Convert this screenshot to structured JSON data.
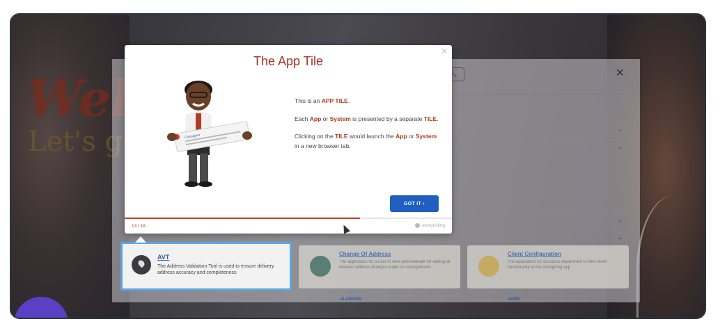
{
  "background": {
    "welcome_text": "Wel",
    "sub_text": "Let's g"
  },
  "app": {
    "tiles": [
      {
        "title": "Change Of Address",
        "description": "The application for a user to view and evaluate for editing all receiver address changes made on consignments"
      },
      {
        "title": "Client Configuration",
        "description": "The application for accounts department to limit client functionality in the consigning app"
      }
    ],
    "row2_labels": [
      "eLANDING",
      "eSIRD"
    ]
  },
  "highlight_tile": {
    "title": "AVT",
    "description": "The Address Validation Tool is used to ensure delivery address accuracy and completeness",
    "icon": "map-pin-icon"
  },
  "tour": {
    "title": "The App Tile",
    "p1_pre": "This is an ",
    "p1_hl": "APP TILE",
    "p1_post": ".",
    "p2_pre": "Each ",
    "p2_hl1": "App",
    "p2_mid": " or ",
    "p2_hl2": "System",
    "p2_mid2": " is presented by a separate ",
    "p2_hl3": "TILE",
    "p2_post": ".",
    "p3_pre": "Clicking on the ",
    "p3_hl1": "TILE",
    "p3_mid": " would launch the ",
    "p3_hl2": "App",
    "p3_mid2": " or ",
    "p3_hl3": "System",
    "p3_post": " in a new browser tab.",
    "button_label": "GOT IT",
    "step": "13 / 18",
    "progress": 0.72,
    "brand": "userguiding",
    "sign_text": "Consigner"
  },
  "colors": {
    "accent": "#a8321e",
    "highlight": "#b2361d",
    "button": "#1f5fbf",
    "tile_border": "#5aa7e2"
  }
}
